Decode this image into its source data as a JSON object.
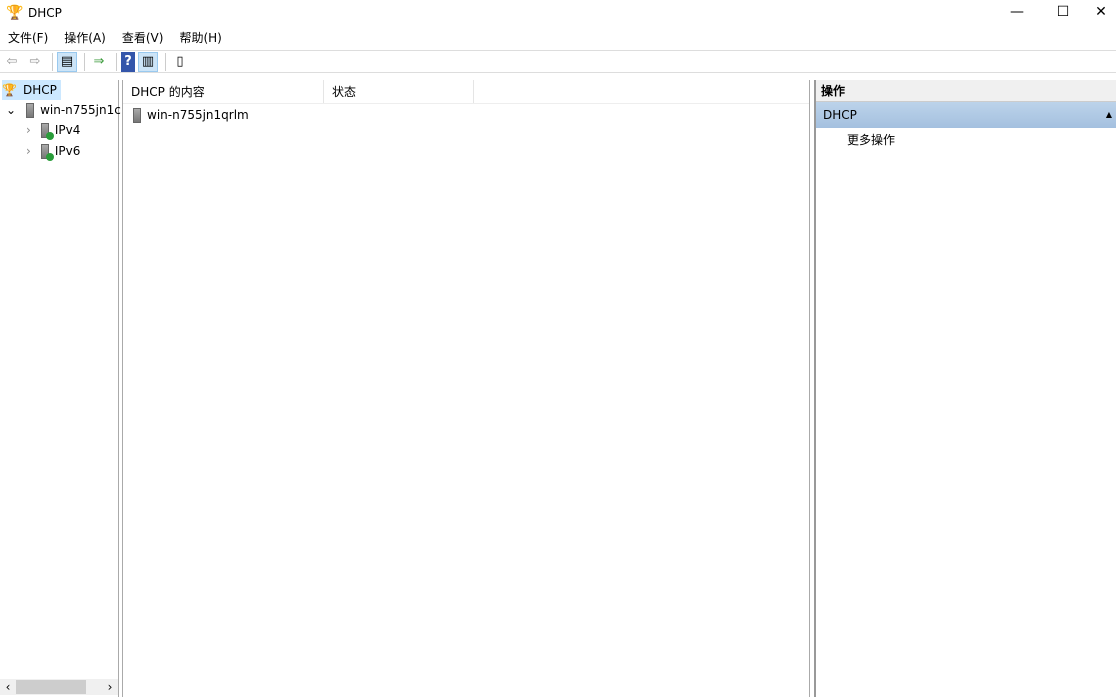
{
  "window": {
    "title": "DHCP"
  },
  "menu": [
    "文件(F)",
    "操作(A)",
    "查看(V)",
    "帮助(H)"
  ],
  "tree": {
    "root": "DHCP",
    "server": "win-n755jn1c",
    "children": [
      "IPv4",
      "IPv6"
    ]
  },
  "content": {
    "columns": [
      "DHCP 的内容",
      "状态"
    ],
    "rows": [
      {
        "name": "win-n755jn1qrlm",
        "status": ""
      }
    ]
  },
  "actions": {
    "header": "操作",
    "section": "DHCP",
    "items": [
      "更多操作"
    ]
  }
}
